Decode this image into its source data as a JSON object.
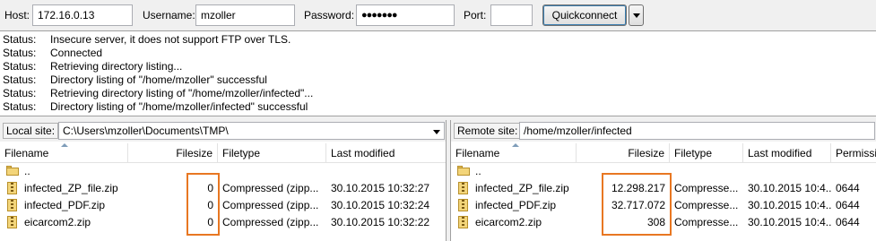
{
  "quickconnect": {
    "host_label": "Host:",
    "host_value": "172.16.0.13",
    "username_label": "Username:",
    "username_value": "mzoller",
    "password_label": "Password:",
    "password_value": "●●●●●●●",
    "port_label": "Port:",
    "port_value": "",
    "connect_label": "Quickconnect"
  },
  "log": [
    {
      "tag": "Status:",
      "message": "Insecure server, it does not support FTP over TLS."
    },
    {
      "tag": "Status:",
      "message": "Connected"
    },
    {
      "tag": "Status:",
      "message": "Retrieving directory listing..."
    },
    {
      "tag": "Status:",
      "message": "Directory listing of \"/home/mzoller\" successful"
    },
    {
      "tag": "Status:",
      "message": "Retrieving directory listing of \"/home/mzoller/infected\"..."
    },
    {
      "tag": "Status:",
      "message": "Directory listing of \"/home/mzoller/infected\" successful"
    }
  ],
  "local": {
    "site_label": "Local site:",
    "path": "C:\\Users\\mzoller\\Documents\\TMP\\",
    "columns": {
      "filename": "Filename",
      "filesize": "Filesize",
      "filetype": "Filetype",
      "modified": "Last modified"
    },
    "parent": "..",
    "files": [
      {
        "name": "infected_ZP_file.zip",
        "size": "0",
        "type": "Compressed (zipp...",
        "modified": "30.10.2015 10:32:27"
      },
      {
        "name": "infected_PDF.zip",
        "size": "0",
        "type": "Compressed (zipp...",
        "modified": "30.10.2015 10:32:24"
      },
      {
        "name": "eicarcom2.zip",
        "size": "0",
        "type": "Compressed (zipp...",
        "modified": "30.10.2015 10:32:22"
      }
    ]
  },
  "remote": {
    "site_label": "Remote site:",
    "path": "/home/mzoller/infected",
    "columns": {
      "filename": "Filename",
      "filesize": "Filesize",
      "filetype": "Filetype",
      "modified": "Last modified",
      "permissions": "Permissi"
    },
    "parent": "..",
    "files": [
      {
        "name": "infected_ZP_file.zip",
        "size": "12.298.217",
        "type": "Compresse...",
        "modified": "30.10.2015 10:4...",
        "perm": "0644"
      },
      {
        "name": "infected_PDF.zip",
        "size": "32.717.072",
        "type": "Compresse...",
        "modified": "30.10.2015 10:4...",
        "perm": "0644"
      },
      {
        "name": "eicarcom2.zip",
        "size": "308",
        "type": "Compresse...",
        "modified": "30.10.2015 10:4...",
        "perm": "0644"
      }
    ]
  },
  "colors": {
    "highlight": "#e87722",
    "accent": "#3c7fb1"
  }
}
